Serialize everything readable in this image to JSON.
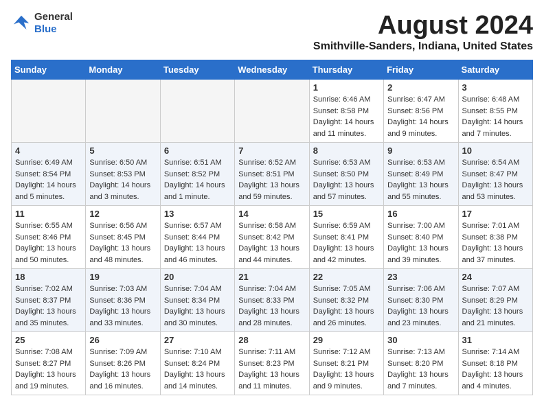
{
  "header": {
    "logo_general": "General",
    "logo_blue": "Blue",
    "month_year": "August 2024",
    "location": "Smithville-Sanders, Indiana, United States"
  },
  "weekdays": [
    "Sunday",
    "Monday",
    "Tuesday",
    "Wednesday",
    "Thursday",
    "Friday",
    "Saturday"
  ],
  "weeks": [
    [
      {
        "day": "",
        "info": ""
      },
      {
        "day": "",
        "info": ""
      },
      {
        "day": "",
        "info": ""
      },
      {
        "day": "",
        "info": ""
      },
      {
        "day": "1",
        "info": "Sunrise: 6:46 AM\nSunset: 8:58 PM\nDaylight: 14 hours and 11 minutes."
      },
      {
        "day": "2",
        "info": "Sunrise: 6:47 AM\nSunset: 8:56 PM\nDaylight: 14 hours and 9 minutes."
      },
      {
        "day": "3",
        "info": "Sunrise: 6:48 AM\nSunset: 8:55 PM\nDaylight: 14 hours and 7 minutes."
      }
    ],
    [
      {
        "day": "4",
        "info": "Sunrise: 6:49 AM\nSunset: 8:54 PM\nDaylight: 14 hours and 5 minutes."
      },
      {
        "day": "5",
        "info": "Sunrise: 6:50 AM\nSunset: 8:53 PM\nDaylight: 14 hours and 3 minutes."
      },
      {
        "day": "6",
        "info": "Sunrise: 6:51 AM\nSunset: 8:52 PM\nDaylight: 14 hours and 1 minute."
      },
      {
        "day": "7",
        "info": "Sunrise: 6:52 AM\nSunset: 8:51 PM\nDaylight: 13 hours and 59 minutes."
      },
      {
        "day": "8",
        "info": "Sunrise: 6:53 AM\nSunset: 8:50 PM\nDaylight: 13 hours and 57 minutes."
      },
      {
        "day": "9",
        "info": "Sunrise: 6:53 AM\nSunset: 8:49 PM\nDaylight: 13 hours and 55 minutes."
      },
      {
        "day": "10",
        "info": "Sunrise: 6:54 AM\nSunset: 8:47 PM\nDaylight: 13 hours and 53 minutes."
      }
    ],
    [
      {
        "day": "11",
        "info": "Sunrise: 6:55 AM\nSunset: 8:46 PM\nDaylight: 13 hours and 50 minutes."
      },
      {
        "day": "12",
        "info": "Sunrise: 6:56 AM\nSunset: 8:45 PM\nDaylight: 13 hours and 48 minutes."
      },
      {
        "day": "13",
        "info": "Sunrise: 6:57 AM\nSunset: 8:44 PM\nDaylight: 13 hours and 46 minutes."
      },
      {
        "day": "14",
        "info": "Sunrise: 6:58 AM\nSunset: 8:42 PM\nDaylight: 13 hours and 44 minutes."
      },
      {
        "day": "15",
        "info": "Sunrise: 6:59 AM\nSunset: 8:41 PM\nDaylight: 13 hours and 42 minutes."
      },
      {
        "day": "16",
        "info": "Sunrise: 7:00 AM\nSunset: 8:40 PM\nDaylight: 13 hours and 39 minutes."
      },
      {
        "day": "17",
        "info": "Sunrise: 7:01 AM\nSunset: 8:38 PM\nDaylight: 13 hours and 37 minutes."
      }
    ],
    [
      {
        "day": "18",
        "info": "Sunrise: 7:02 AM\nSunset: 8:37 PM\nDaylight: 13 hours and 35 minutes."
      },
      {
        "day": "19",
        "info": "Sunrise: 7:03 AM\nSunset: 8:36 PM\nDaylight: 13 hours and 33 minutes."
      },
      {
        "day": "20",
        "info": "Sunrise: 7:04 AM\nSunset: 8:34 PM\nDaylight: 13 hours and 30 minutes."
      },
      {
        "day": "21",
        "info": "Sunrise: 7:04 AM\nSunset: 8:33 PM\nDaylight: 13 hours and 28 minutes."
      },
      {
        "day": "22",
        "info": "Sunrise: 7:05 AM\nSunset: 8:32 PM\nDaylight: 13 hours and 26 minutes."
      },
      {
        "day": "23",
        "info": "Sunrise: 7:06 AM\nSunset: 8:30 PM\nDaylight: 13 hours and 23 minutes."
      },
      {
        "day": "24",
        "info": "Sunrise: 7:07 AM\nSunset: 8:29 PM\nDaylight: 13 hours and 21 minutes."
      }
    ],
    [
      {
        "day": "25",
        "info": "Sunrise: 7:08 AM\nSunset: 8:27 PM\nDaylight: 13 hours and 19 minutes."
      },
      {
        "day": "26",
        "info": "Sunrise: 7:09 AM\nSunset: 8:26 PM\nDaylight: 13 hours and 16 minutes."
      },
      {
        "day": "27",
        "info": "Sunrise: 7:10 AM\nSunset: 8:24 PM\nDaylight: 13 hours and 14 minutes."
      },
      {
        "day": "28",
        "info": "Sunrise: 7:11 AM\nSunset: 8:23 PM\nDaylight: 13 hours and 11 minutes."
      },
      {
        "day": "29",
        "info": "Sunrise: 7:12 AM\nSunset: 8:21 PM\nDaylight: 13 hours and 9 minutes."
      },
      {
        "day": "30",
        "info": "Sunrise: 7:13 AM\nSunset: 8:20 PM\nDaylight: 13 hours and 7 minutes."
      },
      {
        "day": "31",
        "info": "Sunrise: 7:14 AM\nSunset: 8:18 PM\nDaylight: 13 hours and 4 minutes."
      }
    ]
  ]
}
